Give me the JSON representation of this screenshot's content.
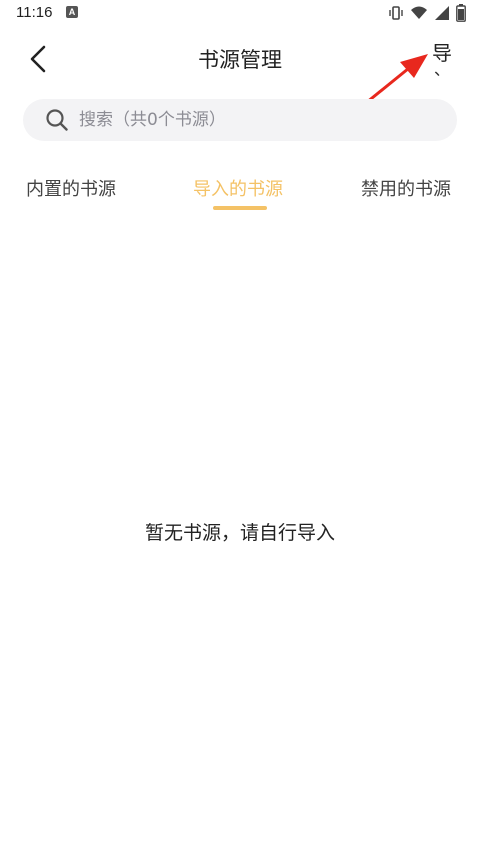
{
  "status_bar": {
    "time": "11:16",
    "notification_letter": "A"
  },
  "header": {
    "title": "书源管理",
    "import_label": "导",
    "import_sub": "、"
  },
  "search": {
    "placeholder": "搜索（共0个书源）"
  },
  "tabs": [
    {
      "label": "内置的书源",
      "active": false
    },
    {
      "label": "导入的书源",
      "active": true
    },
    {
      "label": "禁用的书源",
      "active": false
    }
  ],
  "empty_state": {
    "message": "暂无书源，请自行导入"
  },
  "colors": {
    "accent": "#f4c266",
    "annotation_arrow": "#e8281e",
    "search_bg": "#f3f3f5"
  }
}
